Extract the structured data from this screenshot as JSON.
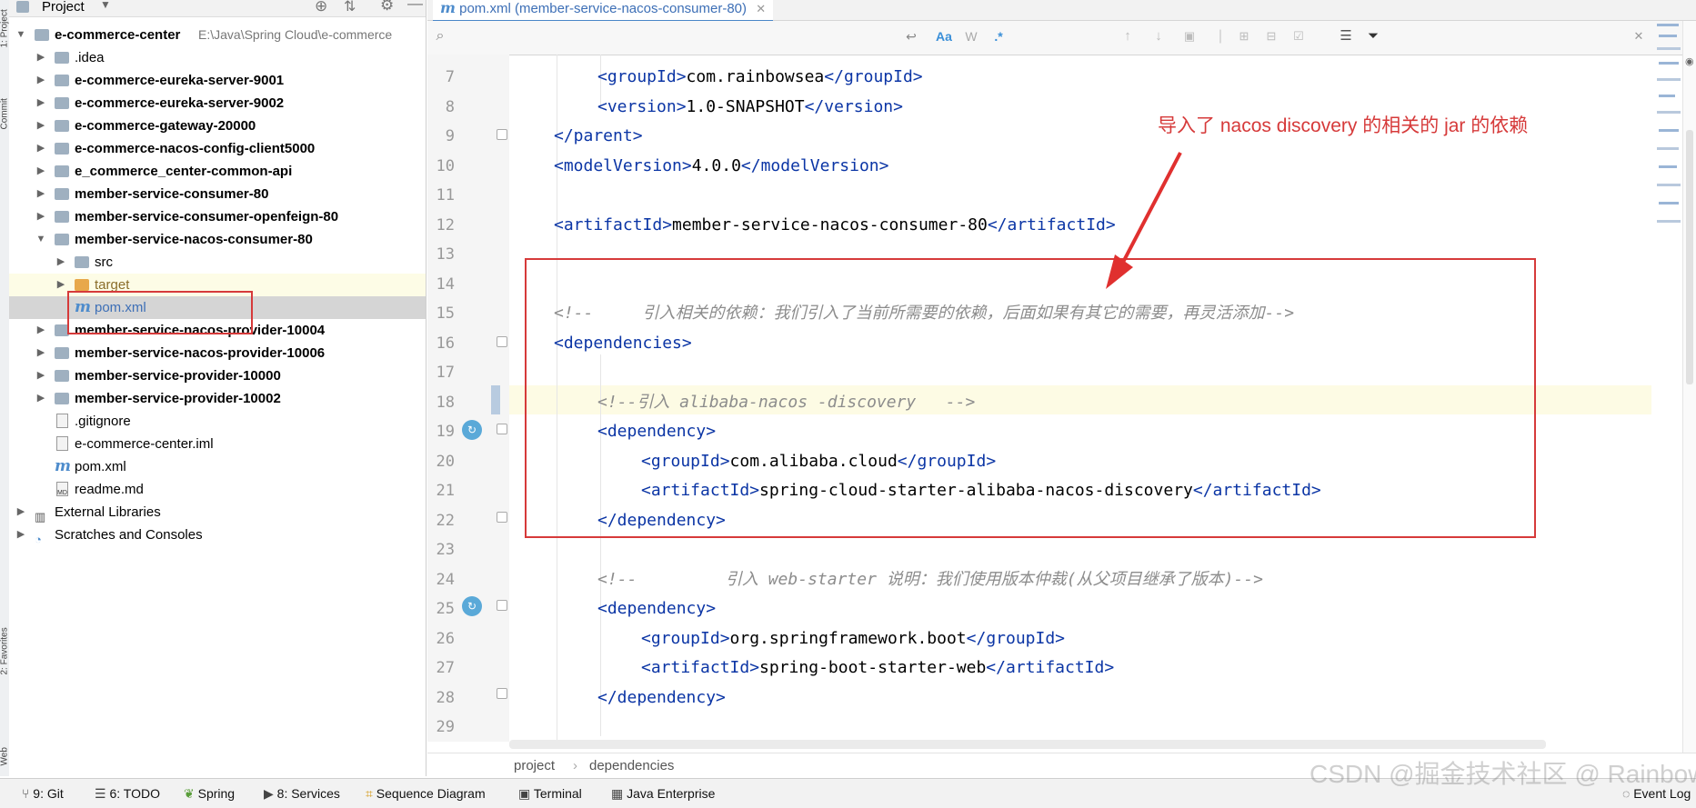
{
  "window": {
    "accent": "#4a86c8",
    "annotation_color": "#d63a3a"
  },
  "left_strip": {
    "top_label": "1: Project",
    "commit_label": "Commit",
    "favorites_label": "2: Favorites",
    "web_label": "Web"
  },
  "project": {
    "header_label": "Project",
    "root": {
      "name": "e-commerce-center",
      "path": "E:\\Java\\Spring Cloud\\e-commerce"
    },
    "items": [
      {
        "label": ".idea"
      },
      {
        "label": "e-commerce-eureka-server-9001"
      },
      {
        "label": "e-commerce-eureka-server-9002"
      },
      {
        "label": "e-commerce-gateway-20000"
      },
      {
        "label": "e-commerce-nacos-config-client5000"
      },
      {
        "label": "e_commerce_center-common-api"
      },
      {
        "label": "member-service-consumer-80"
      },
      {
        "label": "member-service-consumer-openfeign-80"
      },
      {
        "label": "member-service-nacos-consumer-80"
      },
      {
        "label": "src"
      },
      {
        "label": "target"
      },
      {
        "label": "pom.xml"
      },
      {
        "label": "member-service-nacos-provider-10004"
      },
      {
        "label": "member-service-nacos-provider-10006"
      },
      {
        "label": "member-service-provider-10000"
      },
      {
        "label": "member-service-provider-10002"
      },
      {
        "label": ".gitignore"
      },
      {
        "label": "e-commerce-center.iml"
      },
      {
        "label": "pom.xml"
      },
      {
        "label": "readme.md"
      },
      {
        "label": "External Libraries"
      },
      {
        "label": "Scratches and Consoles"
      }
    ]
  },
  "editor": {
    "tab_label": "pom.xml (member-service-nacos-consumer-80)",
    "find": {
      "case_label": "Aa",
      "word_label": "W",
      "regex_label": ".*"
    },
    "lines": [
      {
        "num": "7"
      },
      {
        "num": "8"
      },
      {
        "num": "9"
      },
      {
        "num": "10"
      },
      {
        "num": "11"
      },
      {
        "num": "12"
      },
      {
        "num": "13"
      },
      {
        "num": "14"
      },
      {
        "num": "15"
      },
      {
        "num": "16"
      },
      {
        "num": "17"
      },
      {
        "num": "18"
      },
      {
        "num": "19"
      },
      {
        "num": "20"
      },
      {
        "num": "21"
      },
      {
        "num": "22"
      },
      {
        "num": "23"
      },
      {
        "num": "24"
      },
      {
        "num": "25"
      },
      {
        "num": "26"
      },
      {
        "num": "27"
      },
      {
        "num": "28"
      },
      {
        "num": "29"
      }
    ],
    "code": {
      "l7": {
        "open": "<groupId>",
        "text": "com.rainbowsea",
        "close": "</groupId>"
      },
      "l8": {
        "open": "<version>",
        "text": "1.0-SNAPSHOT",
        "close": "</version>"
      },
      "l9": {
        "close": "</parent>"
      },
      "l10": {
        "open": "<modelVersion>",
        "text": "4.0.0",
        "close": "</modelVersion>"
      },
      "l12": {
        "open": "<artifactId>",
        "text": "member-service-nacos-consumer-80",
        "close": "</artifactId>"
      },
      "l15": {
        "comment": "<!--     引入相关的依赖：我们引入了当前所需要的依赖，后面如果有其它的需要，再灵活添加-->"
      },
      "l16": {
        "open": "<dependencies>"
      },
      "l18": {
        "comment": "<!--引入 alibaba-nacos -discovery   -->"
      },
      "l19": {
        "open": "<dependency>"
      },
      "l20": {
        "open": "<groupId>",
        "text": "com.alibaba.cloud",
        "close": "</groupId>"
      },
      "l21": {
        "open": "<artifactId>",
        "text": "spring-cloud-starter-alibaba-nacos-discovery",
        "close": "</artifactId>"
      },
      "l22": {
        "close": "</dependency>"
      },
      "l24": {
        "comment": "<!--         引入 web-starter 说明：我们使用版本仲裁(从父项目继承了版本)-->"
      },
      "l25": {
        "open": "<dependency>"
      },
      "l26": {
        "open": "<groupId>",
        "text": "org.springframework.boot",
        "close": "</groupId>"
      },
      "l27": {
        "open": "<artifactId>",
        "text": "spring-boot-starter-web",
        "close": "</artifactId>"
      },
      "l28": {
        "close": "</dependency>"
      }
    },
    "annotation": "导入了 nacos discovery 的相关的 jar 的依赖",
    "breadcrumb": [
      "project",
      "dependencies"
    ]
  },
  "bottom_bar": {
    "git": "9: Git",
    "todo": "6: TODO",
    "spring": "Spring",
    "services": "8: Services",
    "sequence": "Sequence Diagram",
    "terminal": "Terminal",
    "java_enterprise": "Java Enterprise",
    "event_log": "Event Log"
  },
  "watermark": "CSDN @掘金技术社区 @ RainbowSea"
}
